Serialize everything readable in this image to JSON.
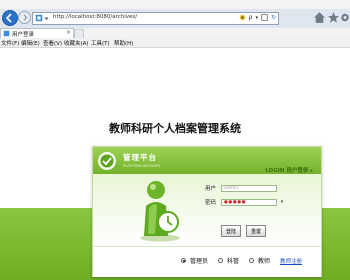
{
  "browser": {
    "url": "http://localhost:8080/archives/",
    "tab_label": "用户登录",
    "tab_close": "×",
    "search_glyph": "ρ",
    "dropdown_glyph": "▾",
    "refresh_glyph": "↻",
    "menu": [
      "文件(F)",
      "编辑(E)",
      "查看(V)",
      "收藏夹(A)",
      "工具(T)",
      "帮助(H)"
    ]
  },
  "page": {
    "title": "教师科研个人档案管理系统",
    "logo_text": "管理平台",
    "logo_subtext": "PLATFORM ARCHIVES",
    "login_label": "LOGIN 用户登录 ▸",
    "username_label": "用户",
    "username_value": "admin",
    "password_label": "密码",
    "password_value": "●●●●●",
    "password_arrow": "▾",
    "login_button": "登陆",
    "reset_button": "重置",
    "roles": [
      "管理员",
      "科管",
      "教师"
    ],
    "selected_role": "管理员",
    "register_link": "教师注册"
  },
  "colors": {
    "accent_green": "#7ab832",
    "dark_green": "#3a6f0f",
    "link_blue": "#1a4fbf",
    "browser_blue": "#2a71c7"
  }
}
